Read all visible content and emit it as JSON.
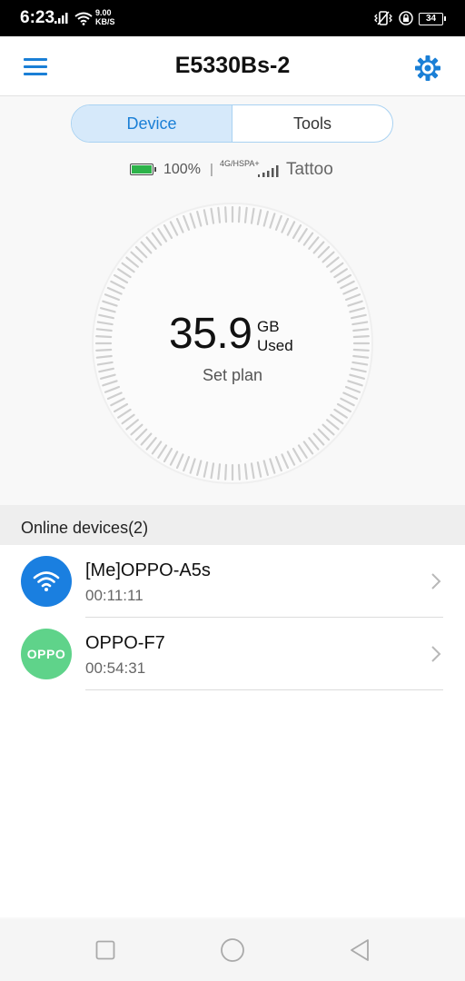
{
  "status_bar": {
    "time": "6:23",
    "speed_value": "9.00",
    "speed_unit": "KB/S",
    "battery": "34"
  },
  "app_bar": {
    "title": "E5330Bs-2",
    "menu_icon": "hamburger-menu-icon",
    "settings_icon": "gear-icon"
  },
  "tabs": [
    {
      "label": "Device",
      "active": true
    },
    {
      "label": "Tools",
      "active": false
    }
  ],
  "status_line": {
    "battery_percent": "100%",
    "separator": "|",
    "network_type": "4G/HSPA+",
    "carrier": "Tattoo"
  },
  "usage": {
    "value": "35.9",
    "unit": "GB",
    "label": "Used",
    "set_plan": "Set plan"
  },
  "devices": {
    "header": "Online devices(2)",
    "items": [
      {
        "name": "[Me]OPPO-A5s",
        "duration": "00:11:11",
        "avatar": "wifi-icon",
        "avatar_text": ""
      },
      {
        "name": "OPPO-F7",
        "duration": "00:54:31",
        "avatar": "oppo-logo",
        "avatar_text": "OPPO"
      }
    ]
  },
  "colors": {
    "accent": "#1a7fd6",
    "segment_active_bg": "#d6e9fa",
    "battery_green": "#2db34a",
    "oppo_green": "#5fd38a"
  }
}
